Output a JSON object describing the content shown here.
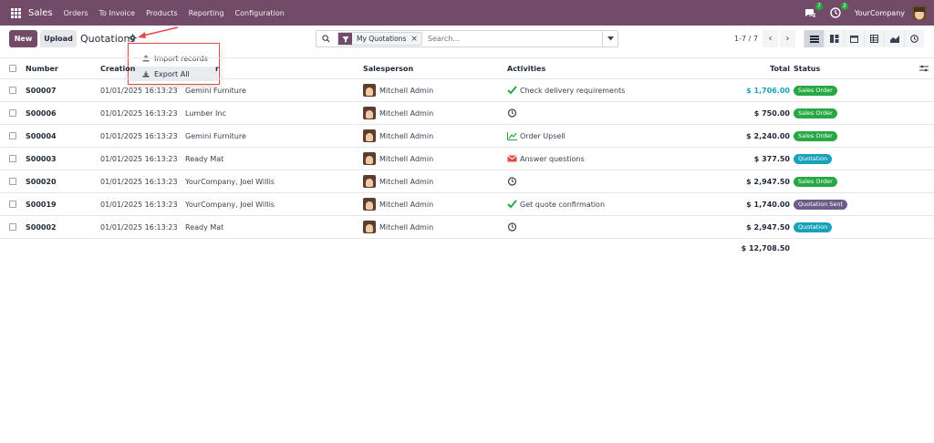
{
  "navbar": {
    "brand": "Sales",
    "menu": [
      "Orders",
      "To Invoice",
      "Products",
      "Reporting",
      "Configuration"
    ],
    "messages_count": "7",
    "activities_count": "2",
    "company": "YourCompany"
  },
  "control": {
    "new_label": "New",
    "upload_label": "Upload",
    "title": "Quotations",
    "dropdown": {
      "import_label": "Import records",
      "export_label": "Export All"
    },
    "search": {
      "facet": "My Quotations",
      "placeholder": "Search..."
    },
    "pager": "1-7 / 7"
  },
  "table": {
    "headers": {
      "number": "Number",
      "creation": "Creation",
      "customer_tail": "r",
      "salesperson": "Salesperson",
      "activities": "Activities",
      "total": "Total",
      "status": "Status"
    },
    "rows": [
      {
        "number": "S00007",
        "date": "01/01/2025 16:13:23",
        "customer": "Gemini Furniture",
        "salesperson": "Mitchell Admin",
        "activity_icon": "check-icon",
        "activity": "Check delivery requirements",
        "total": "$ 1,706.00",
        "status": "Sales Order"
      },
      {
        "number": "S00006",
        "date": "01/01/2025 16:13:23",
        "customer": "Lumber Inc",
        "salesperson": "Mitchell Admin",
        "activity_icon": "clock-icon",
        "activity": "",
        "total": "$ 750.00",
        "status": "Sales Order"
      },
      {
        "number": "S00004",
        "date": "01/01/2025 16:13:23",
        "customer": "Gemini Furniture",
        "salesperson": "Mitchell Admin",
        "activity_icon": "chart-line-icon",
        "activity": "Order Upsell",
        "total": "$ 2,240.00",
        "status": "Sales Order"
      },
      {
        "number": "S00003",
        "date": "01/01/2025 16:13:23",
        "customer": "Ready Mat",
        "salesperson": "Mitchell Admin",
        "activity_icon": "envelope-icon",
        "activity": "Answer questions",
        "total": "$ 377.50",
        "status": "Quotation"
      },
      {
        "number": "S00020",
        "date": "01/01/2025 16:13:23",
        "customer": "YourCompany, Joel Willis",
        "salesperson": "Mitchell Admin",
        "activity_icon": "clock-icon",
        "activity": "",
        "total": "$ 2,947.50",
        "status": "Sales Order"
      },
      {
        "number": "S00019",
        "date": "01/01/2025 16:13:23",
        "customer": "YourCompany, Joel Willis",
        "salesperson": "Mitchell Admin",
        "activity_icon": "check-icon",
        "activity": "Get quote confirmation",
        "total": "$ 1,740.00",
        "status": "Quotation Sent"
      },
      {
        "number": "S00002",
        "date": "01/01/2025 16:13:23",
        "customer": "Ready Mat",
        "salesperson": "Mitchell Admin",
        "activity_icon": "clock-icon",
        "activity": "",
        "total": "$ 2,947.50",
        "status": "Quotation"
      }
    ],
    "grand_total": "$ 12,708.50"
  },
  "colors": {
    "brand": "#714b67",
    "sales_order": "#28a745",
    "quotation": "#17a2b8",
    "quotation_sent": "#6c5c8c",
    "annotation": "#e24a4a"
  }
}
